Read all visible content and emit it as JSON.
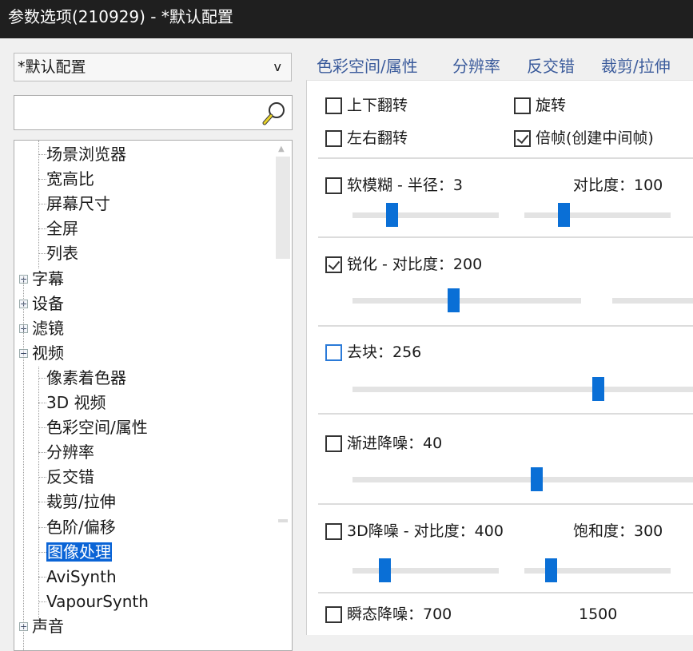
{
  "window": {
    "title": "参数选项(210929) - *默认配置"
  },
  "sidebar": {
    "profile_select": {
      "value": "*默认配置",
      "chevron": "v"
    },
    "search": {
      "value": "",
      "placeholder": "",
      "icon": "search-icon"
    },
    "tree": [
      {
        "label": "场景浏览器",
        "level": 1
      },
      {
        "label": "宽高比",
        "level": 1
      },
      {
        "label": "屏幕尺寸",
        "level": 1
      },
      {
        "label": "全屏",
        "level": 1
      },
      {
        "label": "列表",
        "level": 1
      },
      {
        "label": "字幕",
        "level": 0,
        "expander": "+"
      },
      {
        "label": "设备",
        "level": 0,
        "expander": "+"
      },
      {
        "label": "滤镜",
        "level": 0,
        "expander": "+"
      },
      {
        "label": "视频",
        "level": 0,
        "expander": "−"
      },
      {
        "label": "像素着色器",
        "level": 1
      },
      {
        "label": "3D 视频",
        "level": 1
      },
      {
        "label": "色彩空间/属性",
        "level": 1
      },
      {
        "label": "分辨率",
        "level": 1
      },
      {
        "label": "反交错",
        "level": 1
      },
      {
        "label": "裁剪/拉伸",
        "level": 1
      },
      {
        "label": "色阶/偏移",
        "level": 1
      },
      {
        "label": "图像处理",
        "level": 1,
        "selected": true
      },
      {
        "label": "AviSynth",
        "level": 1
      },
      {
        "label": "VapourSynth",
        "level": 1
      },
      {
        "label": "声音",
        "level": 0,
        "expander": "+"
      }
    ]
  },
  "tabs": [
    "色彩空间/属性",
    "分辨率",
    "反交错",
    "裁剪/拉伸"
  ],
  "panel": {
    "flip_vertical": {
      "label": "上下翻转",
      "checked": false
    },
    "rotate": {
      "label": "旋转",
      "checked": false
    },
    "flip_horizontal": {
      "label": "左右翻转",
      "checked": false
    },
    "double_frame": {
      "label": "倍帧(创建中间帧)",
      "checked": true
    },
    "soft_blur": {
      "label": "软模糊 - 半径：3",
      "checked": false,
      "contrast_label": "对比度：100",
      "radius_pos": 0.27,
      "contrast_pos": 0.27
    },
    "sharpen": {
      "label": "锐化 - 对比度：200",
      "checked": true,
      "pos": 0.44,
      "second_pos": 0
    },
    "deblock": {
      "label": "去块：256",
      "checked": false,
      "pos": 0.72
    },
    "progressive_denoise": {
      "label": "渐进降噪：40",
      "checked": false,
      "pos": 0.54
    },
    "denoise_3d": {
      "label": "3D降噪 - 对比度：400",
      "checked": false,
      "saturation_label": "饱和度：300",
      "contrast_pos": 0.22,
      "saturation_pos": 0.18
    },
    "transient_denoise": {
      "label": "瞬态降噪：700",
      "checked": false,
      "second_value": "1500"
    }
  },
  "colors": {
    "accent": "#0a6fd6",
    "tab_text": "#3c5c9c",
    "titlebar": "#1f1f1f"
  }
}
